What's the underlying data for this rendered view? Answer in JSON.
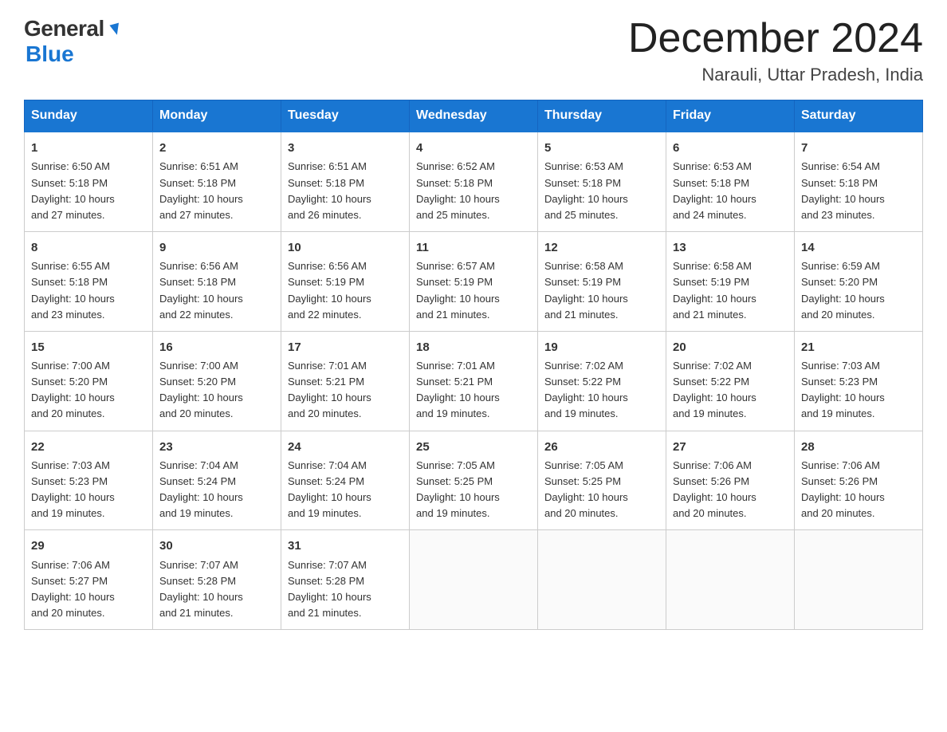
{
  "header": {
    "logo_general": "General",
    "logo_blue": "Blue",
    "month": "December 2024",
    "location": "Narauli, Uttar Pradesh, India"
  },
  "days_of_week": [
    "Sunday",
    "Monday",
    "Tuesday",
    "Wednesday",
    "Thursday",
    "Friday",
    "Saturday"
  ],
  "weeks": [
    [
      {
        "day": "1",
        "sunrise": "6:50 AM",
        "sunset": "5:18 PM",
        "daylight": "10 hours and 27 minutes."
      },
      {
        "day": "2",
        "sunrise": "6:51 AM",
        "sunset": "5:18 PM",
        "daylight": "10 hours and 27 minutes."
      },
      {
        "day": "3",
        "sunrise": "6:51 AM",
        "sunset": "5:18 PM",
        "daylight": "10 hours and 26 minutes."
      },
      {
        "day": "4",
        "sunrise": "6:52 AM",
        "sunset": "5:18 PM",
        "daylight": "10 hours and 25 minutes."
      },
      {
        "day": "5",
        "sunrise": "6:53 AM",
        "sunset": "5:18 PM",
        "daylight": "10 hours and 25 minutes."
      },
      {
        "day": "6",
        "sunrise": "6:53 AM",
        "sunset": "5:18 PM",
        "daylight": "10 hours and 24 minutes."
      },
      {
        "day": "7",
        "sunrise": "6:54 AM",
        "sunset": "5:18 PM",
        "daylight": "10 hours and 23 minutes."
      }
    ],
    [
      {
        "day": "8",
        "sunrise": "6:55 AM",
        "sunset": "5:18 PM",
        "daylight": "10 hours and 23 minutes."
      },
      {
        "day": "9",
        "sunrise": "6:56 AM",
        "sunset": "5:18 PM",
        "daylight": "10 hours and 22 minutes."
      },
      {
        "day": "10",
        "sunrise": "6:56 AM",
        "sunset": "5:19 PM",
        "daylight": "10 hours and 22 minutes."
      },
      {
        "day": "11",
        "sunrise": "6:57 AM",
        "sunset": "5:19 PM",
        "daylight": "10 hours and 21 minutes."
      },
      {
        "day": "12",
        "sunrise": "6:58 AM",
        "sunset": "5:19 PM",
        "daylight": "10 hours and 21 minutes."
      },
      {
        "day": "13",
        "sunrise": "6:58 AM",
        "sunset": "5:19 PM",
        "daylight": "10 hours and 21 minutes."
      },
      {
        "day": "14",
        "sunrise": "6:59 AM",
        "sunset": "5:20 PM",
        "daylight": "10 hours and 20 minutes."
      }
    ],
    [
      {
        "day": "15",
        "sunrise": "7:00 AM",
        "sunset": "5:20 PM",
        "daylight": "10 hours and 20 minutes."
      },
      {
        "day": "16",
        "sunrise": "7:00 AM",
        "sunset": "5:20 PM",
        "daylight": "10 hours and 20 minutes."
      },
      {
        "day": "17",
        "sunrise": "7:01 AM",
        "sunset": "5:21 PM",
        "daylight": "10 hours and 20 minutes."
      },
      {
        "day": "18",
        "sunrise": "7:01 AM",
        "sunset": "5:21 PM",
        "daylight": "10 hours and 19 minutes."
      },
      {
        "day": "19",
        "sunrise": "7:02 AM",
        "sunset": "5:22 PM",
        "daylight": "10 hours and 19 minutes."
      },
      {
        "day": "20",
        "sunrise": "7:02 AM",
        "sunset": "5:22 PM",
        "daylight": "10 hours and 19 minutes."
      },
      {
        "day": "21",
        "sunrise": "7:03 AM",
        "sunset": "5:23 PM",
        "daylight": "10 hours and 19 minutes."
      }
    ],
    [
      {
        "day": "22",
        "sunrise": "7:03 AM",
        "sunset": "5:23 PM",
        "daylight": "10 hours and 19 minutes."
      },
      {
        "day": "23",
        "sunrise": "7:04 AM",
        "sunset": "5:24 PM",
        "daylight": "10 hours and 19 minutes."
      },
      {
        "day": "24",
        "sunrise": "7:04 AM",
        "sunset": "5:24 PM",
        "daylight": "10 hours and 19 minutes."
      },
      {
        "day": "25",
        "sunrise": "7:05 AM",
        "sunset": "5:25 PM",
        "daylight": "10 hours and 19 minutes."
      },
      {
        "day": "26",
        "sunrise": "7:05 AM",
        "sunset": "5:25 PM",
        "daylight": "10 hours and 20 minutes."
      },
      {
        "day": "27",
        "sunrise": "7:06 AM",
        "sunset": "5:26 PM",
        "daylight": "10 hours and 20 minutes."
      },
      {
        "day": "28",
        "sunrise": "7:06 AM",
        "sunset": "5:26 PM",
        "daylight": "10 hours and 20 minutes."
      }
    ],
    [
      {
        "day": "29",
        "sunrise": "7:06 AM",
        "sunset": "5:27 PM",
        "daylight": "10 hours and 20 minutes."
      },
      {
        "day": "30",
        "sunrise": "7:07 AM",
        "sunset": "5:28 PM",
        "daylight": "10 hours and 21 minutes."
      },
      {
        "day": "31",
        "sunrise": "7:07 AM",
        "sunset": "5:28 PM",
        "daylight": "10 hours and 21 minutes."
      },
      null,
      null,
      null,
      null
    ]
  ],
  "labels": {
    "sunrise": "Sunrise:",
    "sunset": "Sunset:",
    "daylight": "Daylight:"
  }
}
